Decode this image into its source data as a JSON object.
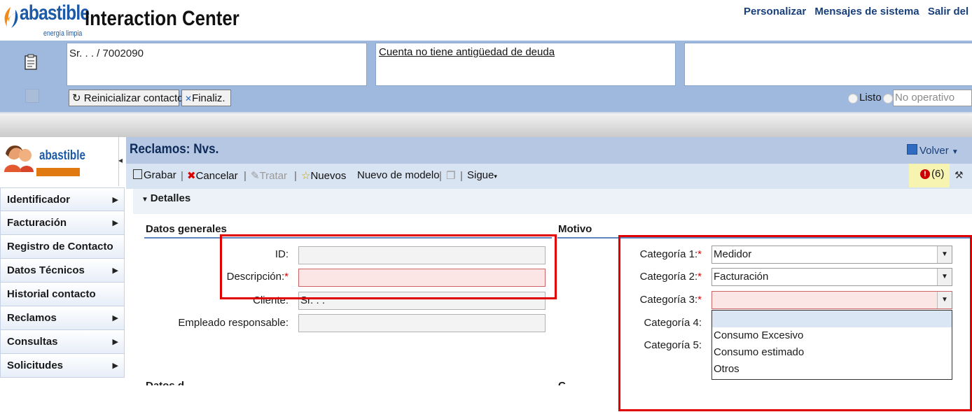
{
  "header": {
    "brand_word": "abastible",
    "brand_tagline": "energía limpia",
    "app_title": "Interaction Center",
    "links": [
      "Personalizar",
      "Mensajes de sistema",
      "Salir del sist"
    ]
  },
  "contact": {
    "name_id": "Sr. . . / 7002090",
    "debt_status": "Cuenta no tiene antigüedad de deuda",
    "reinit_label": "Reinicializar contacto",
    "finalize_label": "Finaliz.",
    "status_ready": "Listo",
    "status_not_operative": "No operativo"
  },
  "nav": {
    "logo_word": "abastible",
    "items": [
      {
        "label": "Identificador",
        "has_sub": true
      },
      {
        "label": "Facturación",
        "has_sub": true
      },
      {
        "label": "Registro de Contacto",
        "has_sub": false
      },
      {
        "label": "Datos Técnicos",
        "has_sub": true
      },
      {
        "label": "Historial contacto",
        "has_sub": false
      },
      {
        "label": "Reclamos",
        "has_sub": true
      },
      {
        "label": "Consultas",
        "has_sub": true
      },
      {
        "label": "Solicitudes",
        "has_sub": true
      }
    ]
  },
  "page": {
    "title": "Reclamos: Nvs.",
    "back_label": "Volver",
    "toolbar": {
      "save": "Grabar",
      "cancel": "Cancelar",
      "process": "Tratar",
      "new": "Nuevos",
      "new_from_template": "Nuevo de modelo",
      "next": "Sigue"
    },
    "message_count": "(6)",
    "details_title": "Detalles"
  },
  "general": {
    "section_title": "Datos generales",
    "id_label": "ID:",
    "id_value": "",
    "desc_label": "Descripción:",
    "desc_value": "",
    "client_label": "Cliente:",
    "client_value": "Sr. . .",
    "employee_label": "Empleado responsable:",
    "employee_value": ""
  },
  "reason": {
    "section_title": "Motivo",
    "cat1_label": "Categoría 1:",
    "cat1_value": "Medidor",
    "cat2_label": "Categoría 2:",
    "cat2_value": "Facturación",
    "cat3_label": "Categoría 3:",
    "cat3_value": "",
    "cat4_label": "Categoría 4:",
    "cat5_label": "Categoría 5:",
    "cat3_options": [
      "",
      "Consumo Excesivo",
      "Consumo estimado",
      "Otros"
    ]
  },
  "colors": {
    "brand_blue": "#1c5aa8",
    "band_blue": "#9fb8de",
    "required_bg": "#fbe5e5",
    "annotation_red": "#e00000"
  }
}
